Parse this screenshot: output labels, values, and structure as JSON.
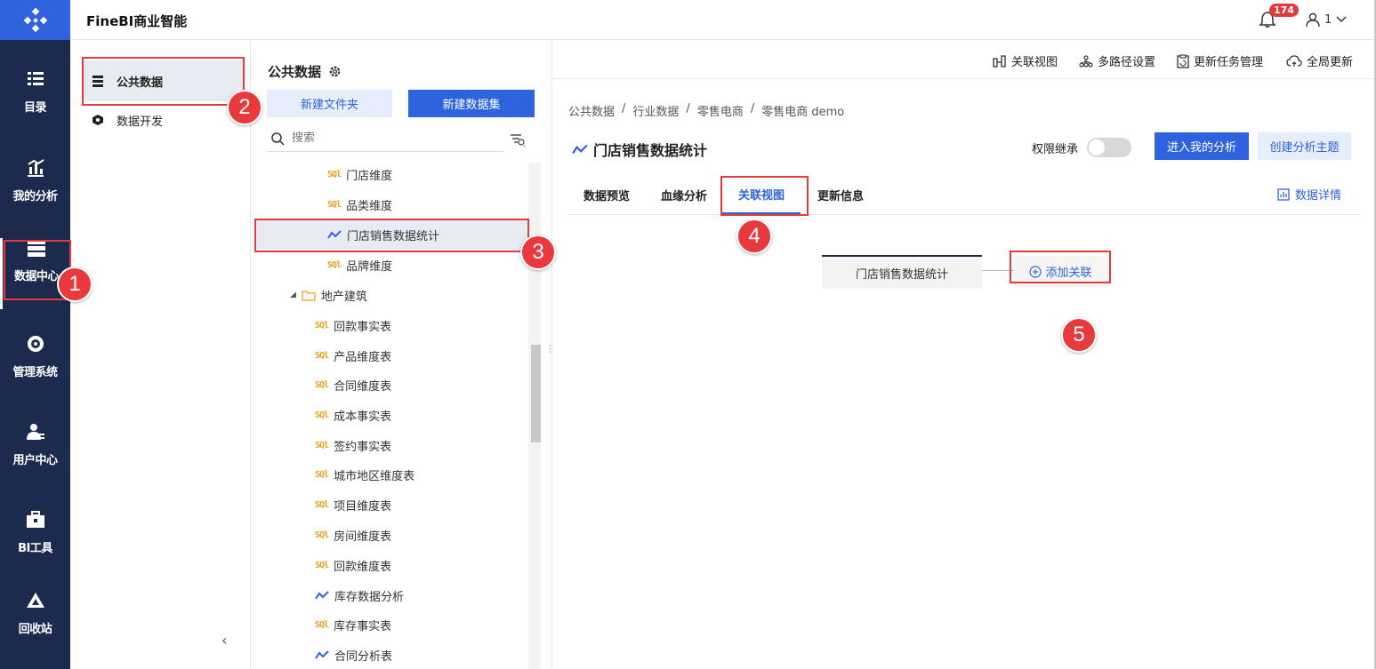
{
  "header": {
    "brand": "FineBI商业智能",
    "notifications": "174",
    "user": "1"
  },
  "nav": [
    {
      "label": "目录",
      "icon": "catalog-icon"
    },
    {
      "label": "我的分析",
      "icon": "analysis-icon"
    },
    {
      "label": "数据中心",
      "icon": "data-center-icon",
      "active": true
    },
    {
      "label": "管理系统",
      "icon": "gear-icon"
    },
    {
      "label": "用户中心",
      "icon": "user-center-icon"
    },
    {
      "label": "BI工具",
      "icon": "toolbox-icon"
    },
    {
      "label": "回收站",
      "icon": "recycle-icon"
    }
  ],
  "side2": {
    "public_data": "公共数据",
    "data_dev": "数据开发"
  },
  "tree": {
    "title": "公共数据",
    "new_folder": "新建文件夹",
    "new_dataset": "新建数据集",
    "search_placeholder": "搜索",
    "rows": [
      {
        "label": "门店维度",
        "type": "sql"
      },
      {
        "label": "品类维度",
        "type": "sql"
      },
      {
        "label": "门店销售数据统计",
        "type": "analysis",
        "selected": true
      },
      {
        "label": "品牌维度",
        "type": "sql"
      },
      {
        "label": "地产建筑",
        "type": "folder"
      },
      {
        "label": "回款事实表",
        "type": "sql"
      },
      {
        "label": "产品维度表",
        "type": "sql"
      },
      {
        "label": "合同维度表",
        "type": "sql"
      },
      {
        "label": "成本事实表",
        "type": "sql"
      },
      {
        "label": "签约事实表",
        "type": "sql"
      },
      {
        "label": "城市地区维度表",
        "type": "sql"
      },
      {
        "label": "项目维度表",
        "type": "sql"
      },
      {
        "label": "房间维度表",
        "type": "sql"
      },
      {
        "label": "回款维度表",
        "type": "sql"
      },
      {
        "label": "库存数据分析",
        "type": "analysis"
      },
      {
        "label": "库存事实表",
        "type": "sql"
      },
      {
        "label": "合同分析表",
        "type": "analysis"
      }
    ]
  },
  "toolbar": {
    "relation_view": "关联视图",
    "multipath": "多路径设置",
    "update_tasks": "更新任务管理",
    "global_update": "全局更新"
  },
  "breadcrumb": [
    "公共数据",
    "行业数据",
    "零售电商",
    "零售电商 demo"
  ],
  "breadcrumb_sep": "/",
  "dataset": {
    "title": "门店销售数据统计",
    "perm_inherit": "权限继承",
    "enter_analysis": "进入我的分析",
    "create_topic": "创建分析主题",
    "data_detail": "数据详情"
  },
  "tabs": [
    "数据预览",
    "血缘分析",
    "关联视图",
    "更新信息"
  ],
  "canvas": {
    "node": "门店销售数据统计",
    "add_link": "添加关联"
  },
  "steps": [
    "1",
    "2",
    "3",
    "4",
    "5"
  ],
  "colors": {
    "nav_bg": "#1c2a4d",
    "accent": "#2f63de",
    "annotation": "#e8393d",
    "sql": "#f0a020"
  }
}
